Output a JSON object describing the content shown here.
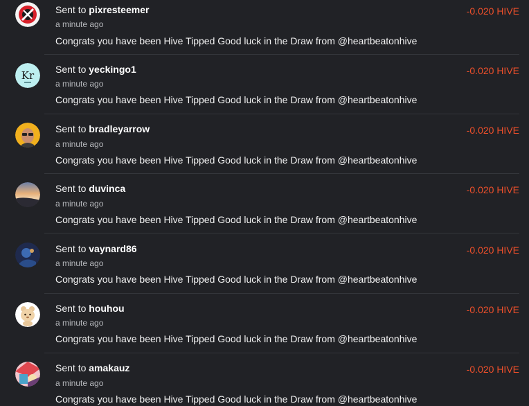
{
  "colors": {
    "background": "#212226",
    "amount": "#f0502b",
    "divider": "#34363b"
  },
  "transfers": [
    {
      "prefix": "Sent to",
      "username": "pixresteemer",
      "time": "a minute ago",
      "memo": "Congrats you have been Hive Tipped Good luck in the Draw from @heartbeatonhive",
      "amount": "-0.020 HIVE",
      "avatar_icon": "red-white-logo-avatar"
    },
    {
      "prefix": "Sent to",
      "username": "yeckingo1",
      "time": "a minute ago",
      "memo": "Congrats you have been Hive Tipped Good luck in the Draw from @heartbeatonhive",
      "amount": "-0.020 HIVE",
      "avatar_icon": "krypton-element-avatar",
      "avatar_text": "Kr"
    },
    {
      "prefix": "Sent to",
      "username": "bradleyarrow",
      "time": "a minute ago",
      "memo": "Congrats you have been Hive Tipped Good luck in the Draw from @heartbeatonhive",
      "amount": "-0.020 HIVE",
      "avatar_icon": "man-with-glasses-avatar"
    },
    {
      "prefix": "Sent to",
      "username": "duvinca",
      "time": "a minute ago",
      "memo": "Congrats you have been Hive Tipped Good luck in the Draw from @heartbeatonhive",
      "amount": "-0.020 HIVE",
      "avatar_icon": "sunset-landscape-avatar"
    },
    {
      "prefix": "Sent to",
      "username": "vaynard86",
      "time": "a minute ago",
      "memo": "Congrats you have been Hive Tipped Good luck in the Draw from @heartbeatonhive",
      "amount": "-0.020 HIVE",
      "avatar_icon": "blue-character-avatar"
    },
    {
      "prefix": "Sent to",
      "username": "houhou",
      "time": "a minute ago",
      "memo": "Congrats you have been Hive Tipped Good luck in the Draw from @heartbeatonhive",
      "amount": "-0.020 HIVE",
      "avatar_icon": "cartoon-bear-avatar"
    },
    {
      "prefix": "Sent to",
      "username": "amakauz",
      "time": "a minute ago",
      "memo": "Congrats you have been Hive Tipped Good luck in the Draw from @heartbeatonhive",
      "amount": "-0.020 HIVE",
      "avatar_icon": "colorful-collage-avatar"
    }
  ]
}
